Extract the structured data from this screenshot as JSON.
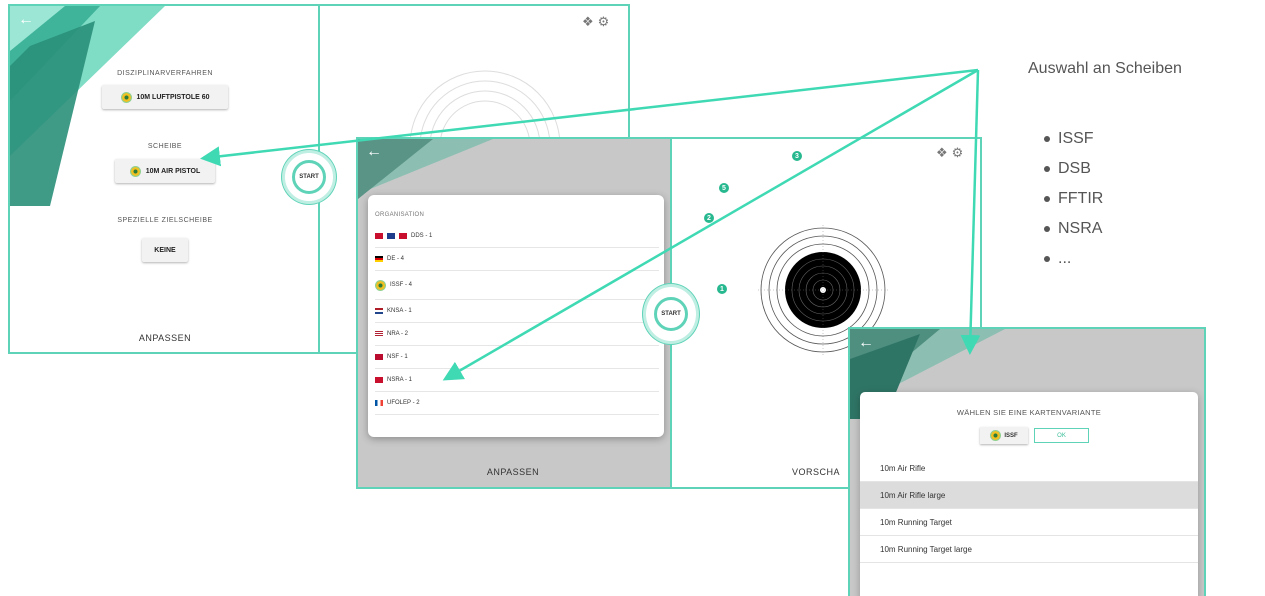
{
  "screen1": {
    "section_discipline": "DISZIPLINARVERFAHREN",
    "discipline_value": "10M LUFTPISTOLE 60",
    "section_target": "SCHEIBE",
    "target_value": "10M AIR PISTOL",
    "section_special": "SPEZIELLE ZIELSCHEIBE",
    "special_value": "KEINE",
    "bottom_label": "ANPASSEN",
    "start_label": "START"
  },
  "screen2": {
    "org_title": "ORGANISATION",
    "organisations": [
      {
        "label": "DDS - 1",
        "flag": "denmark-norway-flags"
      },
      {
        "label": "DE - 4",
        "flag": "germany-flag"
      },
      {
        "label": "ISSF - 4",
        "flag": "issf-logo"
      },
      {
        "label": "KNSA - 1",
        "flag": "netherlands-flag"
      },
      {
        "label": "NRA - 2",
        "flag": "usa-flag"
      },
      {
        "label": "NSF - 1",
        "flag": "norway-flag"
      },
      {
        "label": "NSRA - 1",
        "flag": "uk-flag"
      },
      {
        "label": "UFOLEP - 2",
        "flag": "france-flag"
      }
    ],
    "badges": [
      "3",
      "5",
      "2",
      "1"
    ],
    "bottom_left": "ANPASSEN",
    "bottom_right": "VORSCHA",
    "start_label": "START"
  },
  "screen3": {
    "title": "WÄHLEN SIE EINE KARTENVARIANTE",
    "org_button": "ISSF",
    "ok_button": "OK",
    "variants": [
      "10m Air Rifle",
      "10m Air Rifle large",
      "10m Running Target",
      "10m Running Target large"
    ],
    "selected_index": 1
  },
  "side": {
    "heading": "Auswahl an Scheiben",
    "items": [
      "ISSF",
      "DSB",
      "FFTIR",
      "NSRA",
      "..."
    ]
  },
  "colors": {
    "accent": "#5fd3b8",
    "accent_dark": "#27b88f",
    "arrow": "#3fd9b4"
  }
}
